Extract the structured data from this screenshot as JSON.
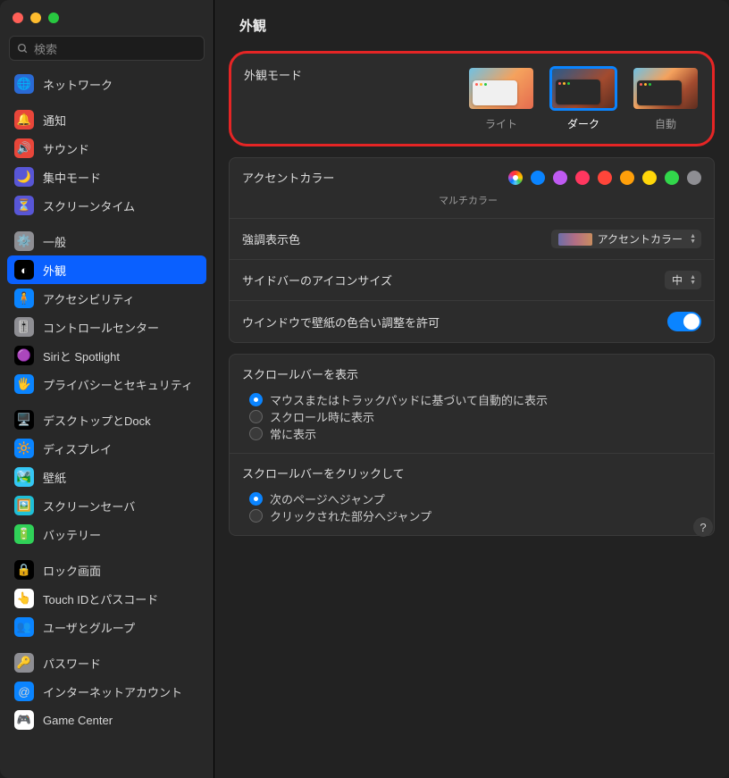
{
  "header": {
    "title": "外観"
  },
  "search": {
    "placeholder": "検索"
  },
  "sidebar_groups": [
    {
      "items": [
        {
          "key": "network",
          "label": "ネットワーク",
          "icon_bg": "#2a6ad4",
          "emoji": "🌐"
        }
      ]
    },
    {
      "items": [
        {
          "key": "notifications",
          "label": "通知",
          "icon_bg": "#e8463a",
          "emoji": "🔔"
        },
        {
          "key": "sound",
          "label": "サウンド",
          "icon_bg": "#e8463a",
          "emoji": "🔊"
        },
        {
          "key": "focus",
          "label": "集中モード",
          "icon_bg": "#5856d6",
          "emoji": "🌙"
        },
        {
          "key": "screentime",
          "label": "スクリーンタイム",
          "icon_bg": "#5856d6",
          "emoji": "⏳"
        }
      ]
    },
    {
      "items": [
        {
          "key": "general",
          "label": "一般",
          "icon_bg": "#8e8e93",
          "emoji": "⚙️"
        },
        {
          "key": "appearance",
          "label": "外観",
          "icon_bg": "#000",
          "emoji": "◐",
          "selected": true
        },
        {
          "key": "accessibility",
          "label": "アクセシビリティ",
          "icon_bg": "#0a84ff",
          "emoji": "🧍"
        },
        {
          "key": "controlcenter",
          "label": "コントロールセンター",
          "icon_bg": "#8e8e93",
          "emoji": "🎚️"
        },
        {
          "key": "siri",
          "label": "Siriと Spotlight",
          "icon_bg": "#000",
          "emoji": "🟣"
        },
        {
          "key": "privacy",
          "label": "プライバシーとセキュリティ",
          "icon_bg": "#0a84ff",
          "emoji": "🖐️"
        }
      ]
    },
    {
      "items": [
        {
          "key": "desktop",
          "label": "デスクトップとDock",
          "icon_bg": "#000",
          "emoji": "🖥️"
        },
        {
          "key": "display",
          "label": "ディスプレイ",
          "icon_bg": "#0a84ff",
          "emoji": "🔆"
        },
        {
          "key": "wallpaper",
          "label": "壁紙",
          "icon_bg": "#34c7f5",
          "emoji": "🏞️"
        },
        {
          "key": "screensaver",
          "label": "スクリーンセーバ",
          "icon_bg": "#1fbfd7",
          "emoji": "🖼️"
        },
        {
          "key": "battery",
          "label": "バッテリー",
          "icon_bg": "#30d158",
          "emoji": "🔋"
        }
      ]
    },
    {
      "items": [
        {
          "key": "lockscreen",
          "label": "ロック画面",
          "icon_bg": "#000",
          "emoji": "🔒"
        },
        {
          "key": "touchid",
          "label": "Touch IDとパスコード",
          "icon_bg": "#fff",
          "emoji": "👆"
        },
        {
          "key": "users",
          "label": "ユーザとグループ",
          "icon_bg": "#0a84ff",
          "emoji": "👥"
        }
      ]
    },
    {
      "items": [
        {
          "key": "passwords",
          "label": "パスワード",
          "icon_bg": "#8e8e93",
          "emoji": "🔑"
        },
        {
          "key": "internetaccounts",
          "label": "インターネットアカウント",
          "icon_bg": "#0a84ff",
          "emoji": "@"
        },
        {
          "key": "gamecenter",
          "label": "Game Center",
          "icon_bg": "#fff",
          "emoji": "🎮"
        }
      ]
    }
  ],
  "appearance_panel": {
    "label": "外観モード",
    "options": [
      {
        "key": "light",
        "label": "ライト",
        "thumb_style": "light"
      },
      {
        "key": "dark",
        "label": "ダーク",
        "thumb_style": "dark",
        "selected": true
      },
      {
        "key": "auto",
        "label": "自動",
        "thumb_style": "auto"
      }
    ]
  },
  "accent": {
    "label": "アクセントカラー",
    "caption": "マルチカラー",
    "colors": [
      {
        "key": "multi",
        "bg": "conic-gradient(#ff3b30,#ff9500,#ffcc00,#34c759,#5ac8fa,#007aff,#af52de,#ff2d55,#ff3b30)",
        "selected": true
      },
      {
        "key": "blue",
        "bg": "#0a84ff"
      },
      {
        "key": "purple",
        "bg": "#bf5af2"
      },
      {
        "key": "pink",
        "bg": "#ff375f"
      },
      {
        "key": "red",
        "bg": "#ff453a"
      },
      {
        "key": "orange",
        "bg": "#ff9f0a"
      },
      {
        "key": "yellow",
        "bg": "#ffd60a"
      },
      {
        "key": "green",
        "bg": "#32d74b"
      },
      {
        "key": "graphite",
        "bg": "#8e8e93"
      }
    ]
  },
  "highlight": {
    "label": "強調表示色",
    "value": "アクセントカラー"
  },
  "sidebar_icon_size": {
    "label": "サイドバーのアイコンサイズ",
    "value": "中"
  },
  "wallpaper_tint": {
    "label": "ウインドウで壁紙の色合い調整を許可",
    "on": true
  },
  "scrollbar_show": {
    "title": "スクロールバーを表示",
    "options": [
      {
        "label": "マウスまたはトラックパッドに基づいて自動的に表示",
        "checked": true
      },
      {
        "label": "スクロール時に表示",
        "checked": false
      },
      {
        "label": "常に表示",
        "checked": false
      }
    ]
  },
  "scrollbar_click": {
    "title": "スクロールバーをクリックして",
    "options": [
      {
        "label": "次のページへジャンプ",
        "checked": true
      },
      {
        "label": "クリックされた部分へジャンプ",
        "checked": false
      }
    ]
  },
  "help": "?"
}
